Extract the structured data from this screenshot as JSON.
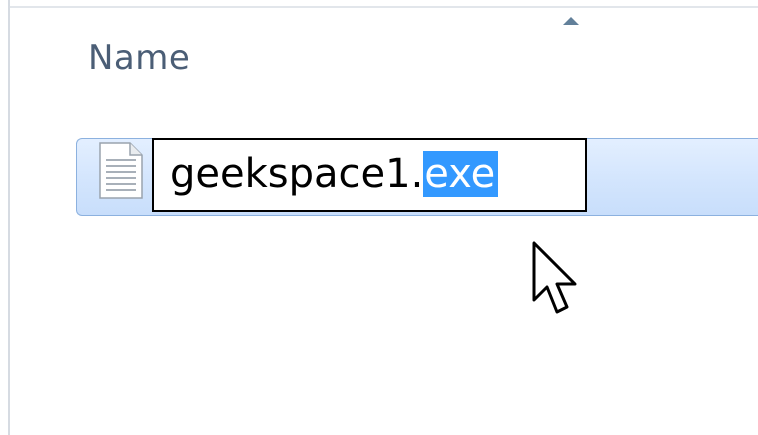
{
  "window": {
    "column_header": "Name",
    "sort_indicator": "sort-ascending-arrow"
  },
  "file": {
    "icon": "text-document-icon",
    "name_base": "geekspace1.",
    "name_extension_selected": "exe",
    "rename_mode": true
  },
  "colors": {
    "selection_highlight": "#3399ff",
    "row_selected_bg": "#d3e5fd",
    "row_border": "#8cb1df",
    "header_text": "#4b5e76"
  },
  "cursor": {
    "icon": "mouse-pointer-arrow"
  }
}
